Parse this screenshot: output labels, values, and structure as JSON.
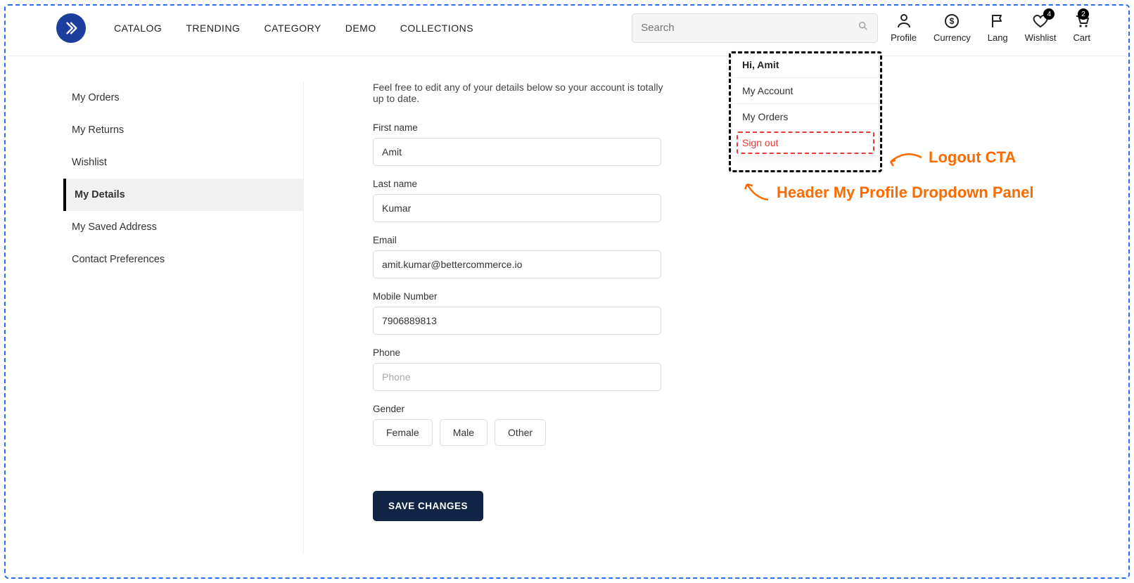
{
  "header": {
    "nav": [
      "CATALOG",
      "TRENDING",
      "CATEGORY",
      "DEMO",
      "COLLECTIONS"
    ],
    "search_placeholder": "Search",
    "icons": {
      "profile": "Profile",
      "currency": "Currency",
      "lang": "Lang",
      "wishlist": "Wishlist",
      "cart": "Cart"
    },
    "wishlist_count": "4",
    "cart_count": "2"
  },
  "dropdown": {
    "greeting": "Hi, Amit",
    "items": [
      "My Account",
      "My Orders"
    ],
    "signout": "Sign out"
  },
  "annotations": {
    "logout": "Logout CTA",
    "panel": "Header My Profile Dropdown Panel"
  },
  "sidebar": {
    "items": [
      "My Orders",
      "My Returns",
      "Wishlist",
      "My Details",
      "My Saved Address",
      "Contact Preferences"
    ],
    "active_index": 3
  },
  "main": {
    "intro": "Feel free to edit any of your details below so your account is totally up to date.",
    "fields": {
      "first_name": {
        "label": "First name",
        "value": "Amit"
      },
      "last_name": {
        "label": "Last name",
        "value": "Kumar"
      },
      "email": {
        "label": "Email",
        "value": "amit.kumar@bettercommerce.io"
      },
      "mobile": {
        "label": "Mobile Number",
        "value": "7906889813"
      },
      "phone": {
        "label": "Phone",
        "value": "",
        "placeholder": "Phone"
      },
      "gender": {
        "label": "Gender",
        "options": [
          "Female",
          "Male",
          "Other"
        ]
      }
    },
    "save_label": "SAVE CHANGES"
  }
}
